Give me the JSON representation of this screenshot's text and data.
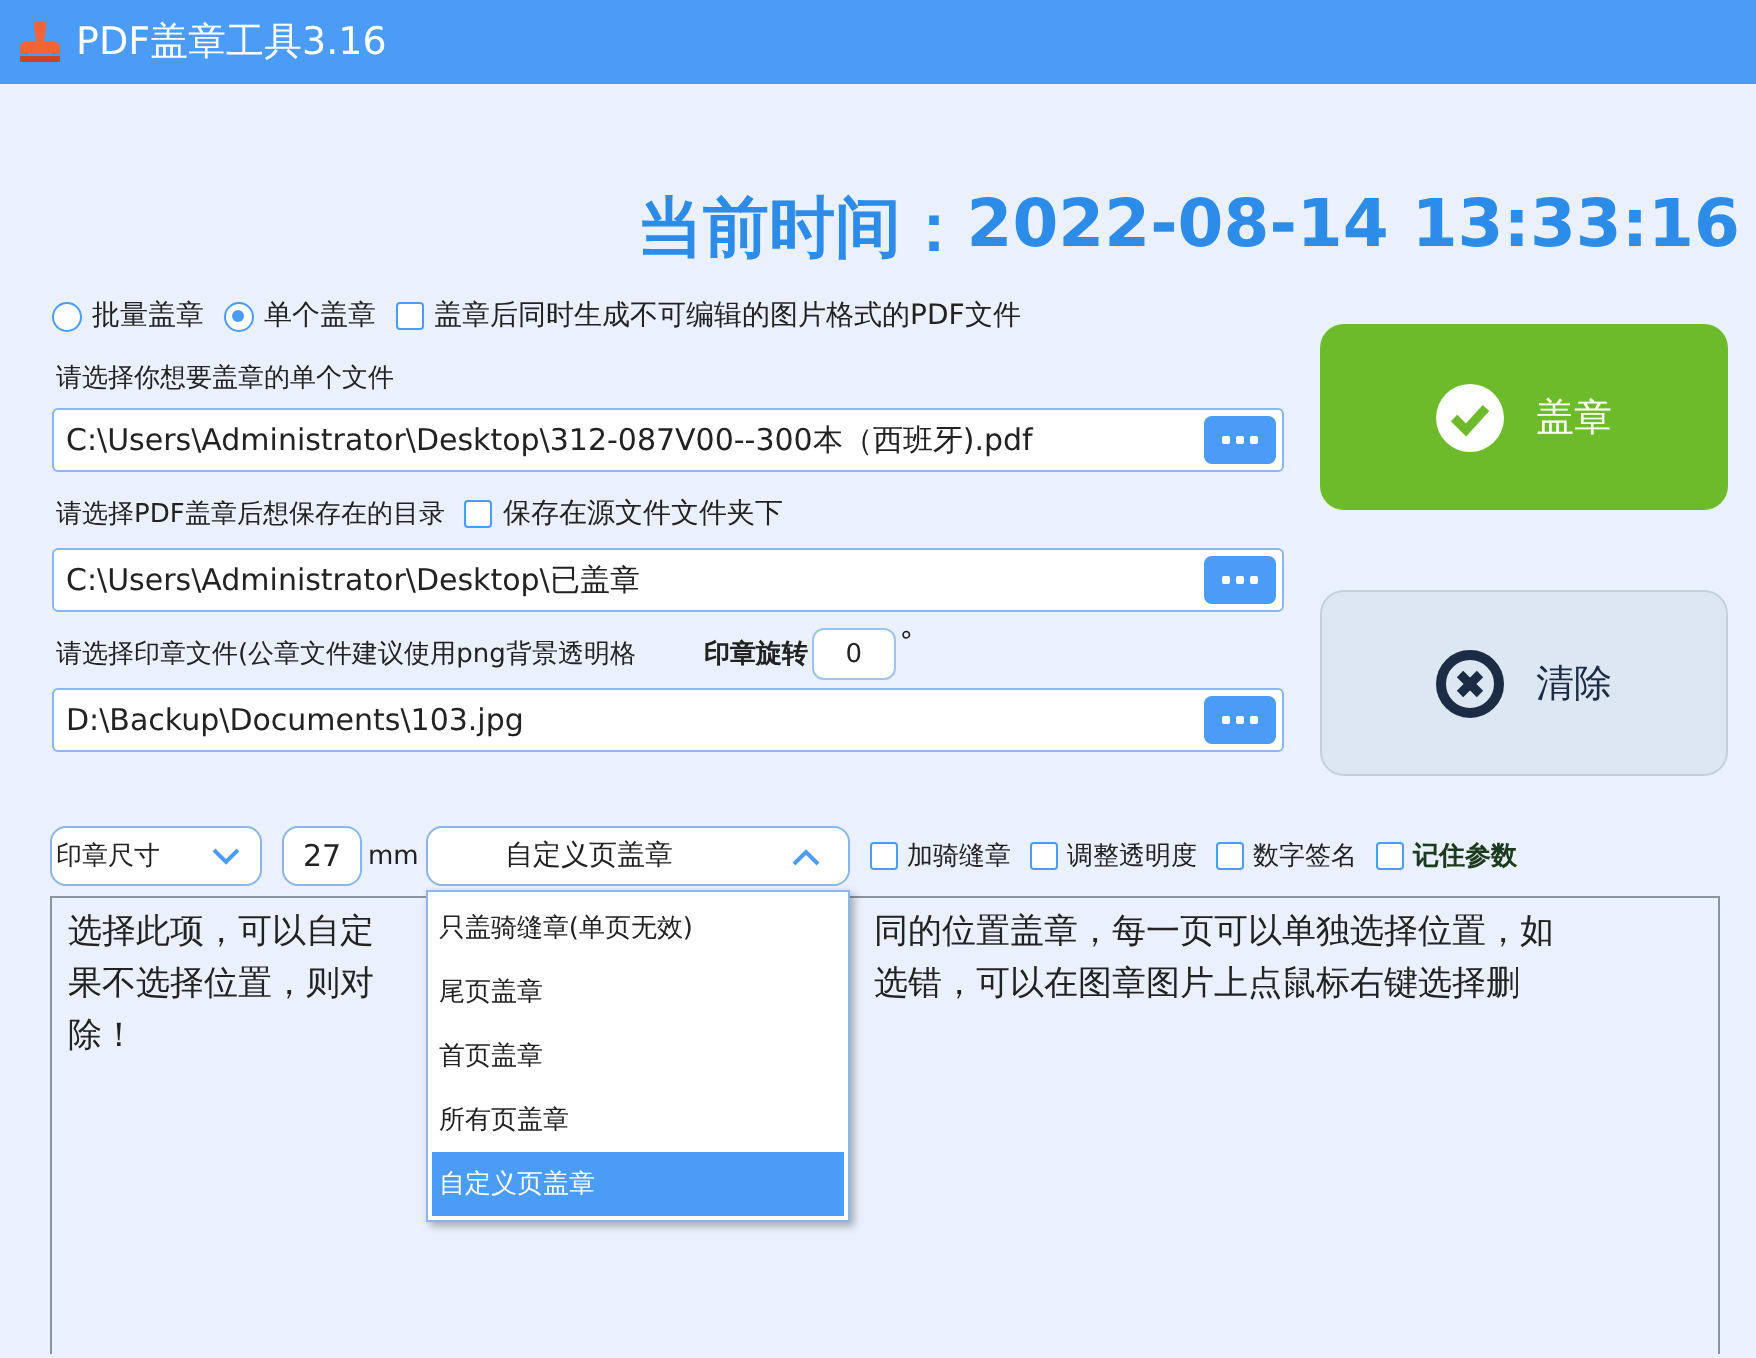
{
  "window": {
    "title": "PDF盖章工具3.16"
  },
  "clock": {
    "label": "当前时间：",
    "value": "2022-08-14 13:33:16"
  },
  "mode_options": [
    {
      "label": "批量盖章",
      "selected": false
    },
    {
      "label": "单个盖章",
      "selected": true
    }
  ],
  "image_pdf_option": {
    "label": "盖章后同时生成不可编辑的图片格式的PDF文件",
    "checked": false
  },
  "file_field": {
    "label": "请选择你想要盖章的单个文件",
    "value": "C:\\Users\\Administrator\\Desktop\\312-087V00--300本（西班牙).pdf"
  },
  "output_field": {
    "label": "请选择PDF盖章后想保存在的目录",
    "value": "C:\\Users\\Administrator\\Desktop\\已盖章"
  },
  "save_in_source": {
    "label": "保存在源文件文件夹下",
    "checked": false
  },
  "stamp_field": {
    "label": "请选择印章文件(公章文件建议使用png背景透明格",
    "value": "D:\\Backup\\Documents\\103.jpg"
  },
  "rotation": {
    "label": "印章旋转",
    "value": "0",
    "unit": "°"
  },
  "stamp_button": {
    "label": "盖章"
  },
  "clear_button": {
    "label": "清除"
  },
  "size_select": {
    "value": "印章尺寸"
  },
  "size_input": {
    "value": "27",
    "unit": "mm"
  },
  "page_mode": {
    "value": "自定义页盖章",
    "expanded": true,
    "options": [
      {
        "label": "只盖骑缝章(单页无效)",
        "selected": false
      },
      {
        "label": "尾页盖章",
        "selected": false
      },
      {
        "label": "首页盖章",
        "selected": false
      },
      {
        "label": "所有页盖章",
        "selected": false
      },
      {
        "label": "自定义页盖章",
        "selected": true
      }
    ]
  },
  "options": [
    {
      "label": "加骑缝章",
      "checked": false,
      "bold": false
    },
    {
      "label": "调整透明度",
      "checked": false,
      "bold": false
    },
    {
      "label": "数字签名",
      "checked": false,
      "bold": false
    },
    {
      "label": "记住参数",
      "checked": false,
      "bold": true
    }
  ],
  "help_text": {
    "lines": [
      [
        "选择此项，可以自定",
        "同的位置盖章，每一页可以单独选择位置，如"
      ],
      [
        "果不选择位置，则对",
        "选错，可以在图章图片上点鼠标右键选择删"
      ],
      [
        "除！"
      ]
    ]
  }
}
